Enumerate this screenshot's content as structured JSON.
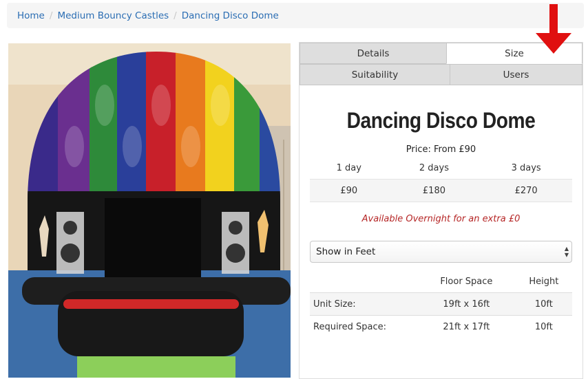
{
  "breadcrumb": {
    "items": [
      "Home",
      "Medium Bouncy Castles",
      "Dancing Disco Dome"
    ]
  },
  "tabs": {
    "details": "Details",
    "size": "Size",
    "suitability": "Suitability",
    "users": "Users",
    "active": "Size"
  },
  "product": {
    "title": "Dancing Disco Dome",
    "price_from": "Price: From £90",
    "price_table": {
      "headers": [
        "1 day",
        "2 days",
        "3 days"
      ],
      "values": [
        "£90",
        "£180",
        "£270"
      ]
    },
    "overnight": "Available Overnight for an extra £0"
  },
  "units": {
    "selected": "Show in Feet"
  },
  "size_table": {
    "headers": [
      "",
      "Floor Space",
      "Height"
    ],
    "rows": [
      {
        "label": "Unit Size:",
        "floor": "19ft x 16ft",
        "height": "10ft"
      },
      {
        "label": "Required Space:",
        "floor": "21ft x 17ft",
        "height": "10ft"
      }
    ]
  },
  "colors": {
    "link": "#2a6db3",
    "overnight_text": "#b52525",
    "annotation_arrow": "#e01010"
  },
  "icons": [
    "red-arrow-icon",
    "select-arrows-icon"
  ]
}
